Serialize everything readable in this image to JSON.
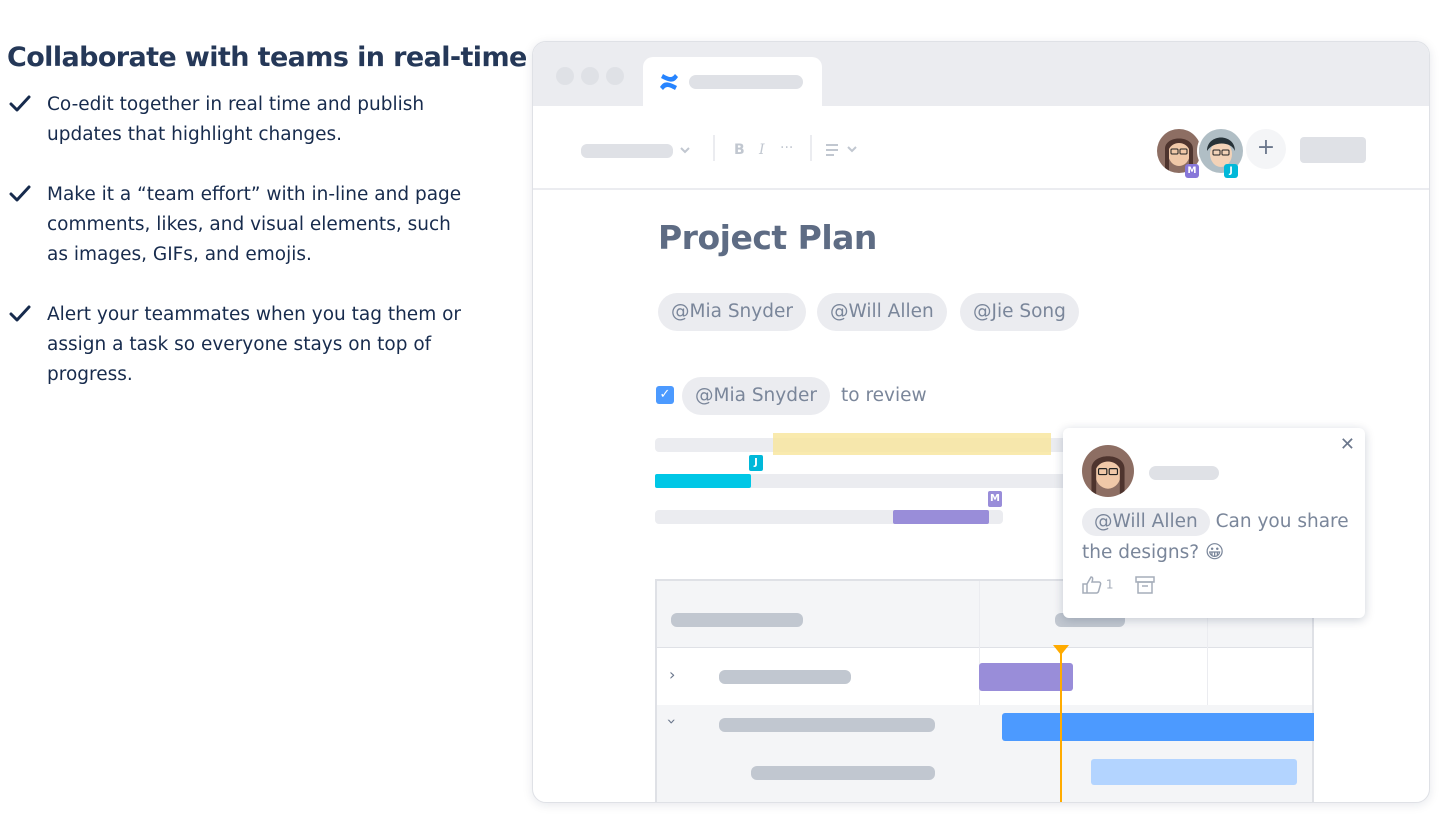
{
  "headline": "Collaborate with teams in real-time",
  "bullets": [
    {
      "line1": "Co-edit together in real time and publish",
      "line2": "updates that highlight changes.",
      "line3": ""
    },
    {
      "line1": "Make it a “team effort” with in-line and page",
      "line2": "comments, likes, and visual elements, such",
      "line3": "as images, GIFs, and emojis."
    },
    {
      "line1": "Alert your teammates when you tag them or",
      "line2": "assign a task so everyone stays on top of",
      "line3": "progress."
    }
  ],
  "editor": {
    "page_title": "Project Plan",
    "mentions": [
      "@Mia Snyder",
      "@Will Allen",
      "@Jie Song"
    ],
    "task": {
      "assignee": "@Mia Snyder",
      "text": "to review",
      "checked": true
    },
    "toolbar": {
      "bold": "B",
      "italic": "I",
      "more": "···",
      "add_user": "+"
    },
    "collaborators": [
      {
        "initial": "M",
        "color": "#8777d9"
      },
      {
        "initial": "J",
        "color": "#00b8d9"
      }
    ],
    "cursor_flags": {
      "j": "J",
      "m": "M"
    },
    "comment": {
      "mention": "@Will Allen",
      "text_a": " Can you share",
      "text_b": "the designs? ",
      "emoji": "😀",
      "like_count": "1"
    }
  },
  "colors": {
    "brand_blue": "#2684ff",
    "purple": "#998dd9",
    "cyan": "#00c7e6",
    "yellow_highlight": "#f8e6a0",
    "today_line": "#ffab00",
    "bar_blue": "#4c9aff",
    "bar_light_blue": "#b3d4ff"
  }
}
